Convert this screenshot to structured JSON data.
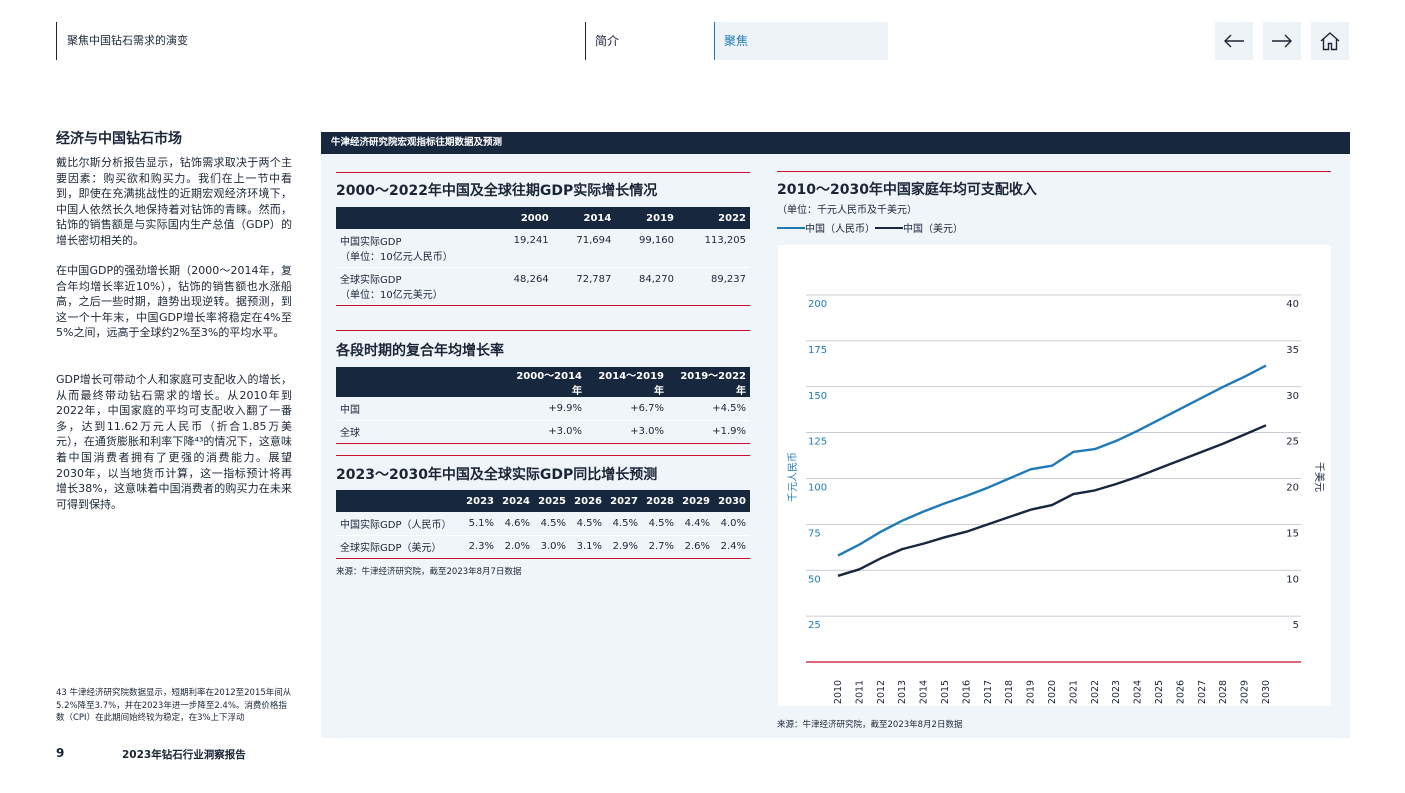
{
  "header": {
    "title": "聚焦中国钻石需求的演变",
    "nav_intro": "简介",
    "nav_focus": "聚焦"
  },
  "left": {
    "heading": "经济与中国钻石市场",
    "paragraphs": [
      "戴比尔斯分析报告显示，钻饰需求取决于两个主要因素：购买欲和购买力。我们在上一节中看到，即使在充满挑战性的近期宏观经济环境下，中国人依然长久地保持着对钻饰的青睐。然而，钻饰的销售额是与实际国内生产总值（GDP）的增长密切相关的。",
      "在中国GDP的强劲增长期（2000～2014年，复合年均增长率近10%），钻饰的销售额也水涨船高，之后一些时期，趋势出现逆转。据预测，到这一个十年末，中国GDP增长率将稳定在4%至5%之间，远高于全球约2%至3%的平均水平。",
      "GDP增长可带动个人和家庭可支配收入的增长，从而最终带动钻石需求的增长。从2010年到2022年，中国家庭的平均可支配收入翻了一番多，达到11.62万元人民币（折合1.85万美元），在通货膨胀和利率下降⁴³的情况下，这意味着中国消费者拥有了更强的消费能力。展望2030年，以当地货币计算，这一指标预计将再增长38%，这意味着中国消费者的购买力在未来可得到保持。"
    ],
    "footnote": "43 牛津经济研究院数据显示，短期利率在2012至2015年间从5.2%降至3.7%，并在2023年进一步降至2.4%。消费价格指数（CPI）在此期间始终较为稳定，在3%上下浮动",
    "page_number": "9",
    "report_title": "2023年钻石行业洞察报告"
  },
  "panel": {
    "title": "牛津经济研究院宏观指标往期数据及预测",
    "gdp": {
      "heading": "2000～2022年中国及全球往期GDP实际增长情况",
      "columns": [
        "2000",
        "2014",
        "2019",
        "2022"
      ],
      "rows": [
        {
          "label1": "中国实际GDP",
          "label2": "（单位：10亿元人民币）",
          "values": [
            "19,241",
            "71,694",
            "99,160",
            "113,205"
          ]
        },
        {
          "label1": "全球实际GDP",
          "label2": "（单位：10亿元美元）",
          "values": [
            "48,264",
            "72,787",
            "84,270",
            "89,237"
          ]
        }
      ]
    },
    "cagr": {
      "heading": "各段时期的复合年均增长率",
      "columns": [
        "2000～2014年",
        "2014～2019年",
        "2019～2022年"
      ],
      "rows": [
        {
          "label": "中国",
          "values": [
            "+9.9%",
            "+6.7%",
            "+4.5%"
          ]
        },
        {
          "label": "全球",
          "values": [
            "+3.0%",
            "+3.0%",
            "+1.9%"
          ]
        }
      ]
    },
    "forecast": {
      "heading": "2023～2030年中国及全球实际GDP同比增长预测",
      "columns": [
        "2023",
        "2024",
        "2025",
        "2026",
        "2027",
        "2028",
        "2029",
        "2030"
      ],
      "rows": [
        {
          "label": "中国实际GDP（人民币）",
          "values": [
            "5.1%",
            "4.6%",
            "4.5%",
            "4.5%",
            "4.5%",
            "4.5%",
            "4.4%",
            "4.0%"
          ]
        },
        {
          "label": "全球实际GDP（美元）",
          "values": [
            "2.3%",
            "2.0%",
            "3.0%",
            "3.1%",
            "2.9%",
            "2.7%",
            "2.6%",
            "2.4%"
          ]
        }
      ]
    },
    "source_left": "来源：牛津经济研究院，截至2023年8月7日数据",
    "source_right": "来源：牛津经济研究院，截至2023年8月2日数据"
  },
  "colors": {
    "navy": "#16273e",
    "accent_blue": "#1f7ab8",
    "red": "#c8102e",
    "panel_bg": "#f0f5fa"
  },
  "chart_data": {
    "type": "line",
    "title": "2010～2030年中国家庭年均可支配收入",
    "subtitle": "（单位：千元人民币及千美元）",
    "ylabel": "千元人民币",
    "ylabel_right": "千美元",
    "ylim": [
      0,
      200
    ],
    "ylim_right": [
      0,
      40
    ],
    "yticks": [
      25,
      50,
      75,
      100,
      125,
      150,
      175,
      200
    ],
    "yticks_right": [
      5,
      10,
      15,
      20,
      25,
      30,
      35,
      40
    ],
    "legend_position": "top-left",
    "grid": true,
    "x": [
      "2010",
      "2011",
      "2012",
      "2013",
      "2014",
      "2015",
      "2016",
      "2017",
      "2018",
      "2019",
      "2020",
      "2021",
      "2022",
      "2023",
      "2024",
      "2025",
      "2026",
      "2027",
      "2028",
      "2029",
      "2030"
    ],
    "series": [
      {
        "name": "中国（人民币）",
        "color": "#1f7ab8",
        "axis": "left",
        "values": [
          58,
          64,
          71,
          77,
          82,
          86.5,
          90.5,
          95,
          100,
          105,
          107,
          114.5,
          116,
          120.5,
          126,
          132,
          138,
          144,
          150,
          155.5,
          161.5
        ]
      },
      {
        "name": "中国（美元）",
        "color": "#16273e",
        "axis": "right",
        "values": [
          9.4,
          10.1,
          11.3,
          12.3,
          12.9,
          13.6,
          14.2,
          15.0,
          15.8,
          16.6,
          17.1,
          18.3,
          18.7,
          19.4,
          20.2,
          21.1,
          22.0,
          22.9,
          23.8,
          24.8,
          25.8
        ]
      }
    ]
  }
}
